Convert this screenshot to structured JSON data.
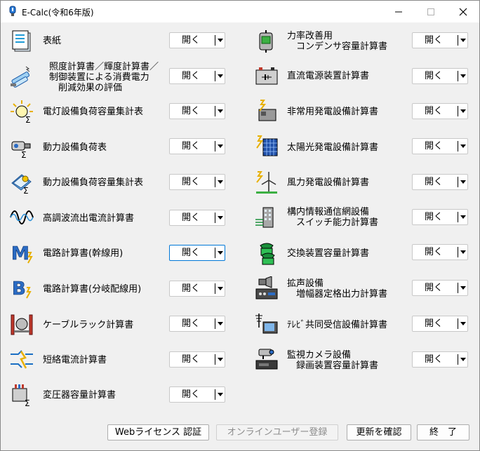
{
  "window": {
    "title": "E-Calc(令和6年版)"
  },
  "open_label": "開く",
  "left_items": [
    {
      "lines": [
        "表紙"
      ],
      "icon": "document-icon"
    },
    {
      "lines": [
        "照度計算書／輝度計算書／",
        "制御装置による消費電力",
        "　削減効果の評価"
      ],
      "icon": "fluorescent-lamp-icon"
    },
    {
      "lines": [
        "電灯設備負荷容量集計表"
      ],
      "icon": "light-bulb-icon"
    },
    {
      "lines": [
        "動力設備負荷表"
      ],
      "icon": "motor-icon"
    },
    {
      "lines": [
        "動力設備負荷容量集計表"
      ],
      "icon": "motor-document-icon"
    },
    {
      "lines": [
        "高調波流出電流計算書"
      ],
      "icon": "harmonic-wave-icon"
    },
    {
      "lines": [
        "電路計算書(幹線用)"
      ],
      "icon": "main-circuit-icon"
    },
    {
      "lines": [
        "電路計算書(分岐配線用)"
      ],
      "icon": "branch-circuit-icon"
    },
    {
      "lines": [
        "ケーブルラック計算書"
      ],
      "icon": "cable-rack-icon"
    },
    {
      "lines": [
        "短絡電流計算書"
      ],
      "icon": "short-circuit-icon"
    },
    {
      "lines": [
        "変圧器容量計算書"
      ],
      "icon": "transformer-icon"
    }
  ],
  "right_items": [
    {
      "lines": [
        "力率改善用",
        "　コンデンサ容量計算書"
      ],
      "icon": "capacitor-icon"
    },
    {
      "lines": [
        "直流電源装置計算書"
      ],
      "icon": "battery-icon"
    },
    {
      "lines": [
        "非常用発電設備計算書"
      ],
      "icon": "generator-icon"
    },
    {
      "lines": [
        "太陽光発電設備計算書"
      ],
      "icon": "solar-panel-icon"
    },
    {
      "lines": [
        "風力発電設備計算書"
      ],
      "icon": "wind-turbine-icon"
    },
    {
      "lines": [
        "構内情報通信網設備",
        "　スイッチ能力計算書"
      ],
      "icon": "network-building-icon"
    },
    {
      "lines": [
        "交換装置容量計算書"
      ],
      "icon": "telephone-icon"
    },
    {
      "lines": [
        "拡声設備",
        "　増幅器定格出力計算書"
      ],
      "icon": "amplifier-icon"
    },
    {
      "lines": [
        "ﾃﾚﾋﾞ共同受信設備計算書"
      ],
      "icon": "tv-antenna-icon"
    },
    {
      "lines": [
        "監視カメラ設備",
        "　録画装置容量計算書"
      ],
      "icon": "surveillance-camera-icon"
    }
  ],
  "buttons": {
    "web_license": "Webライセンス 認証",
    "online_register": "オンラインユーザー登録",
    "check_update": "更新を確認",
    "exit": "終　了"
  }
}
